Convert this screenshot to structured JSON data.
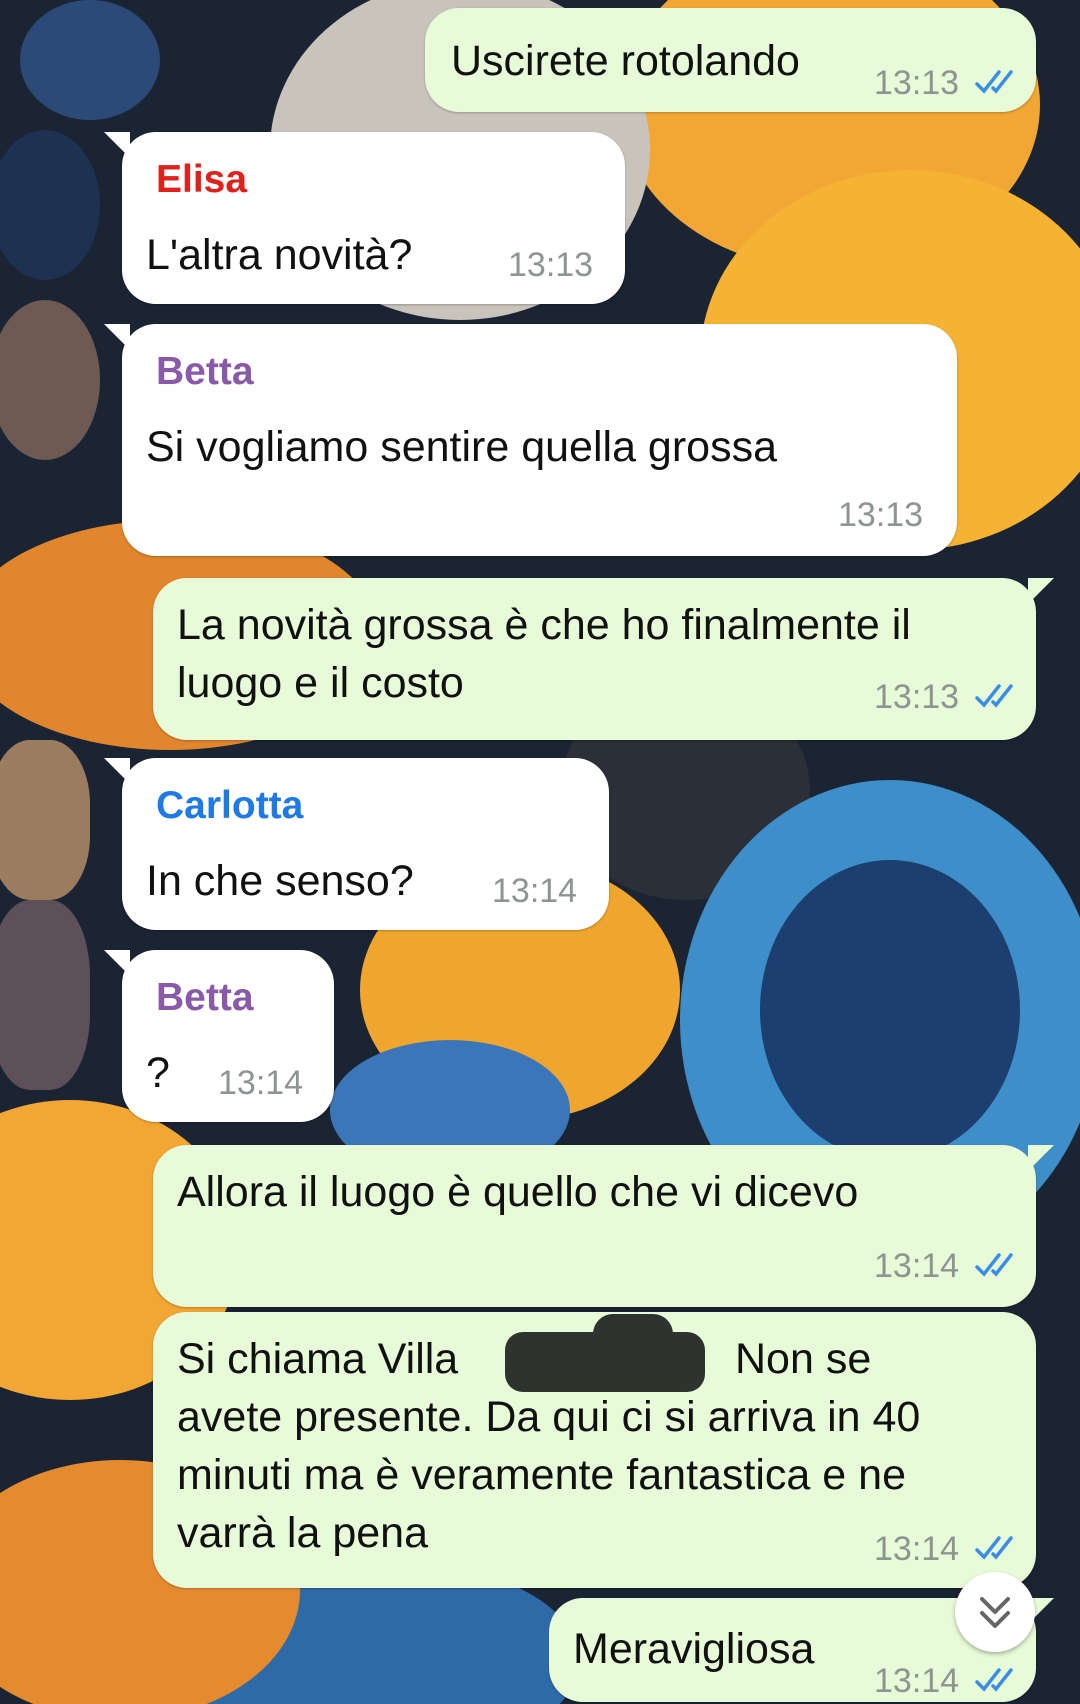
{
  "messages": [
    {
      "direction": "out",
      "text": "Uscirete rotolando",
      "time": "13:13",
      "status": "read"
    },
    {
      "direction": "in",
      "sender": "Elisa",
      "sender_color": "#e0201b",
      "text": "L'altra novità?",
      "time": "13:13"
    },
    {
      "direction": "in",
      "sender": "Betta",
      "sender_color": "#8a5aa8",
      "text": "Si vogliamo sentire quella grossa",
      "time": "13:13"
    },
    {
      "direction": "out",
      "text_line1": "La novità grossa è che ho finalmente il",
      "text_line2": "luogo e il costo",
      "time": "13:13",
      "status": "read"
    },
    {
      "direction": "in",
      "sender": "Carlotta",
      "sender_color": "#1f7ae8",
      "text": "In che senso?",
      "time": "13:14"
    },
    {
      "direction": "in",
      "sender": "Betta",
      "sender_color": "#8a5aa8",
      "text": "?",
      "time": "13:14"
    },
    {
      "direction": "out",
      "text": "Allora il luogo è quello che vi dicevo",
      "time": "13:14",
      "status": "read"
    },
    {
      "direction": "out",
      "line1_a": "Si chiama Villa",
      "line1_b": "Non se",
      "line2": "avete presente. Da qui ci si arriva in 40",
      "line3": "minuti ma è veramente fantastica e ne",
      "line4": "varrà la pena",
      "time": "13:14",
      "status": "read"
    },
    {
      "direction": "out",
      "text": "Meravigliosa",
      "time": "13:14",
      "status": "read"
    }
  ],
  "scroll_down_icon": "double-chevron-down-icon",
  "colors": {
    "outgoing_bubble": "#e7fbd8",
    "incoming_bubble": "#ffffff",
    "read_ticks": "#3b8ee8"
  }
}
